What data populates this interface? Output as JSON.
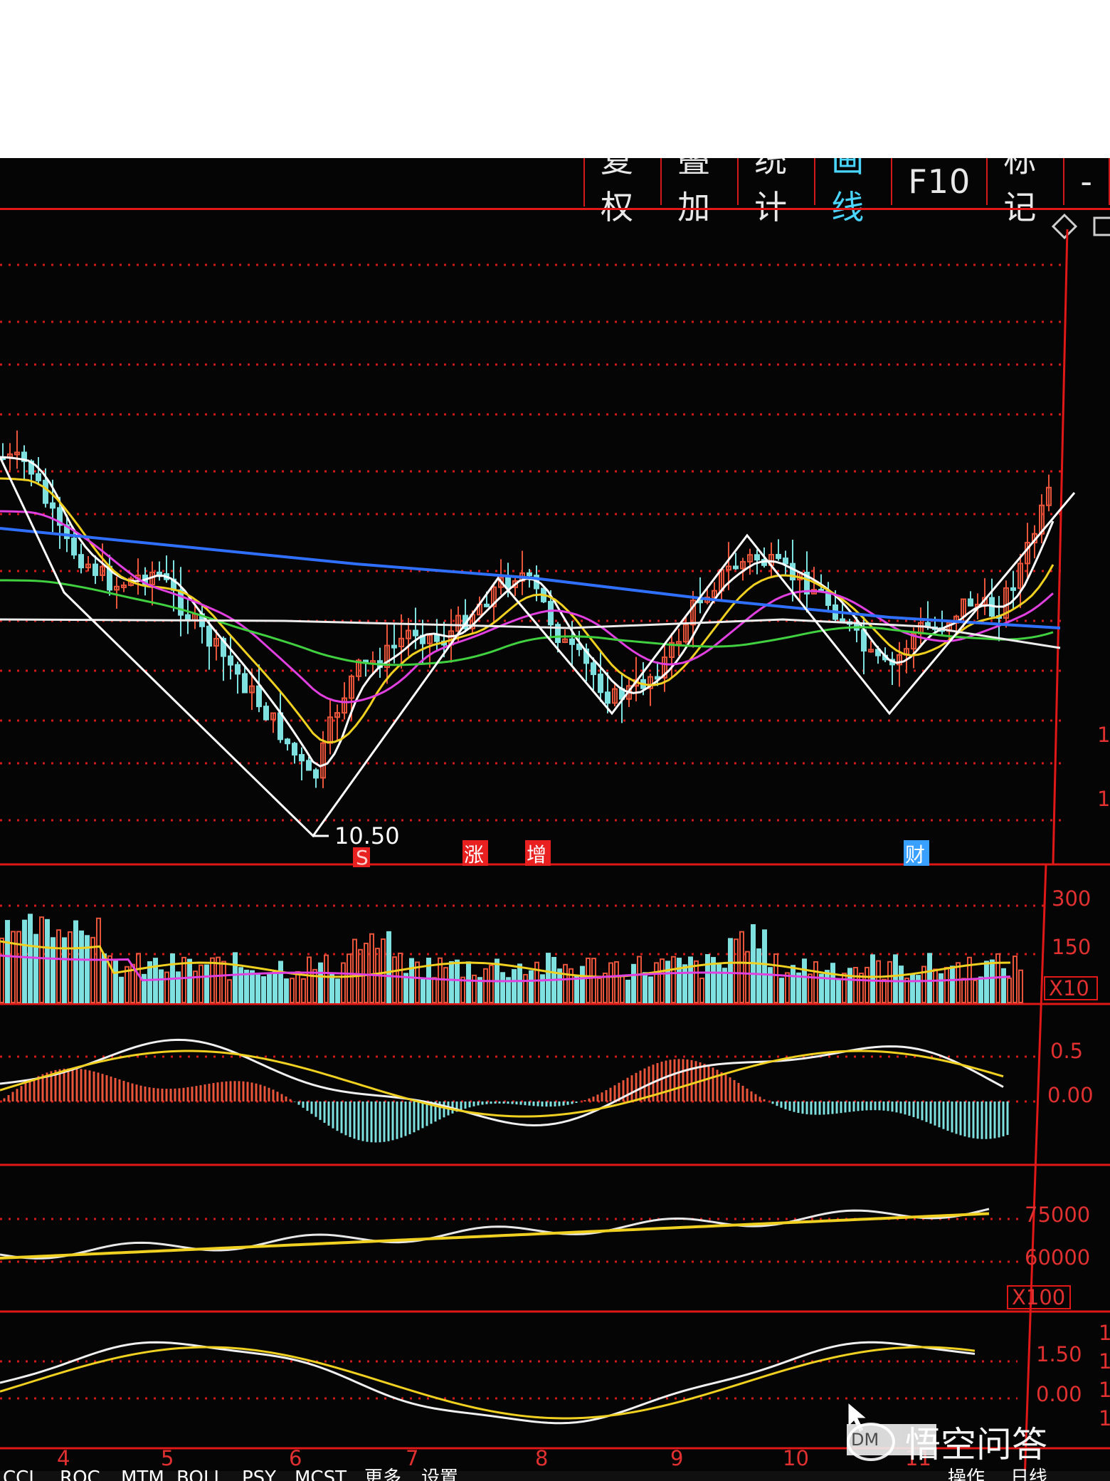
{
  "toolbar": {
    "buttons": [
      {
        "label": "复权",
        "active": false
      },
      {
        "label": "叠加",
        "active": false
      },
      {
        "label": "统计",
        "active": false
      },
      {
        "label": "画线",
        "active": true
      },
      {
        "label": "F10",
        "active": false
      },
      {
        "label": "标记",
        "active": false
      },
      {
        "label": "-",
        "active": false
      }
    ]
  },
  "icons": [
    "diamond-icon",
    "square-icon",
    "cursor-icon",
    "watermark-logo-icon"
  ],
  "main_panel": {
    "low_label": "10.50",
    "markers": [
      {
        "text": "S",
        "color": "#e82020"
      },
      {
        "text": "涨",
        "color": "#e82020"
      },
      {
        "text": "增",
        "color": "#e82020"
      },
      {
        "text": "财",
        "color": "#3aa0ff"
      }
    ],
    "right_ticks": [
      "1",
      "1"
    ]
  },
  "volume_panel": {
    "ticks": [
      "300",
      "150"
    ],
    "multiplier": "X10"
  },
  "macd_panel": {
    "ticks": [
      "0.5",
      "0.00"
    ]
  },
  "obv_panel": {
    "ticks": [
      "75000",
      "60000"
    ],
    "multiplier": "X100"
  },
  "dma_panel": {
    "ticks": [
      "1.50",
      "0.00"
    ],
    "right_edge_ticks": [
      "1",
      "1",
      "1",
      "1"
    ]
  },
  "x_axis": {
    "labels": [
      "4",
      "5",
      "6",
      "7",
      "8",
      "9",
      "10",
      "11"
    ]
  },
  "bottom_tabs": [
    "CCI",
    "ROC",
    "MTM",
    "BOLL",
    "PSY",
    "MCST",
    "更多",
    "设置",
    "操作",
    "日线"
  ],
  "tooltip": {
    "text": "DM"
  },
  "watermark": {
    "text": "悟空问答"
  },
  "colors": {
    "background": "#050505",
    "grid": "#d21a1a",
    "up": "#e8553a",
    "down": "#7fe0e0",
    "ma_white": "#ffffff",
    "ma_yellow": "#f0d020",
    "ma_magenta": "#e040e0",
    "ma_green": "#40d040",
    "ma_blue": "#3070ff",
    "active_button": "#4ad6ff"
  }
}
